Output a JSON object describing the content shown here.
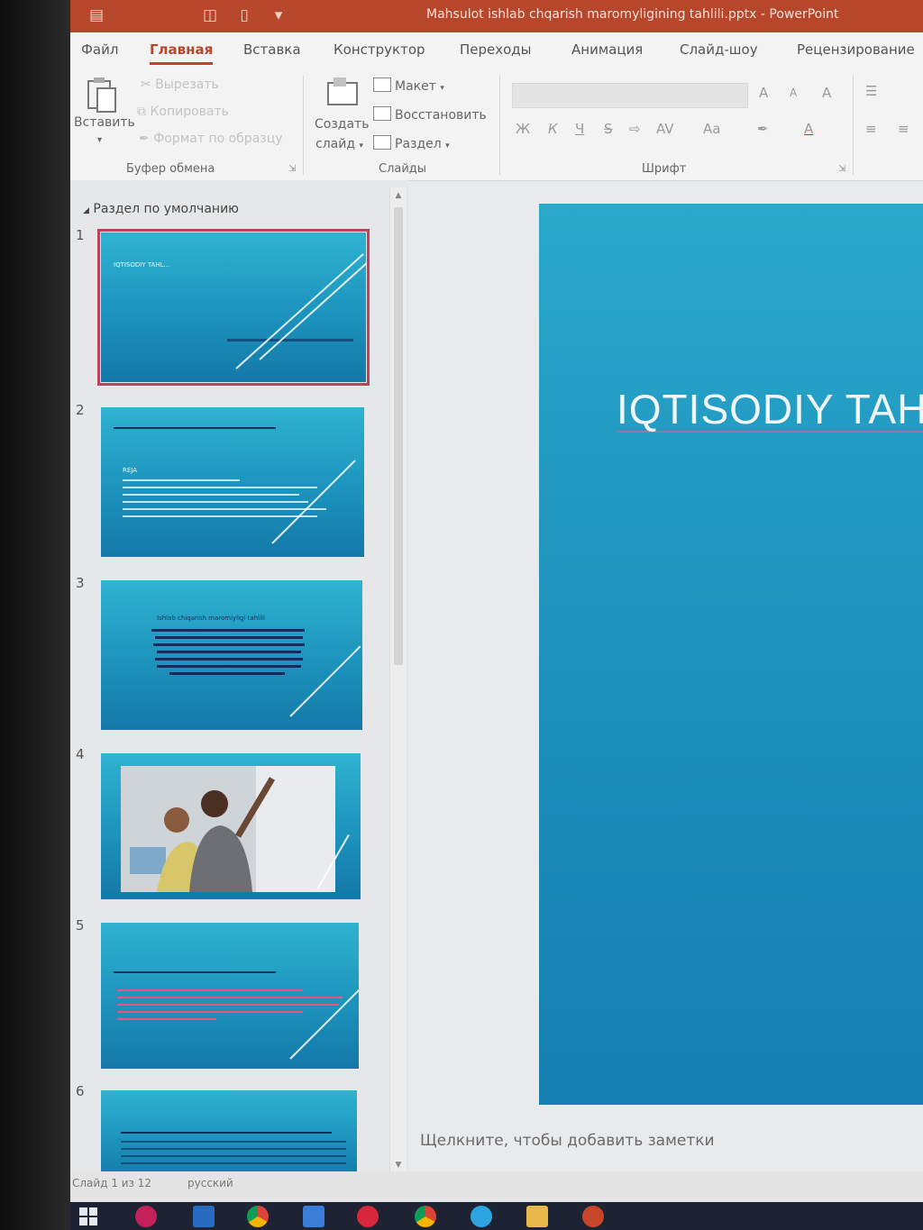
{
  "window": {
    "title": "Mahsulot ishlab chqarish maromyligining tahlili.pptx  -  PowerPoint",
    "qa_icons": [
      "save-icon",
      "present-icon",
      "new-file-icon",
      "customize-icon"
    ]
  },
  "ribbon_tabs": [
    "Файл",
    "Главная",
    "Вставка",
    "Конструктор",
    "Переходы",
    "Анимация",
    "Слайд-шоу",
    "Рецензирование"
  ],
  "ribbon": {
    "clipboard": {
      "paste": "Вставить",
      "cut": "Вырезать",
      "copy": "Копировать",
      "format_painter": "Формат по образцу",
      "label": "Буфер обмена"
    },
    "slides": {
      "new_slide_1": "Создать",
      "new_slide_2": "слайд",
      "layout": "Макет",
      "reset": "Восстановить",
      "section": "Раздел",
      "label": "Слайды"
    },
    "font": {
      "label": "Шрифт",
      "bold": "Ж",
      "italic": "К",
      "underline": "Ч",
      "strike": "S",
      "spacing": "AV",
      "case": "Aa",
      "grow": "A",
      "shrink": "A",
      "clear": "A",
      "color": "A"
    }
  },
  "thumbnails": {
    "section_label": "Раздел по умолчанию",
    "slides": [
      {
        "num": "1",
        "title": "IQTISODIY TAHL..."
      },
      {
        "num": "2",
        "title": "REJA"
      },
      {
        "num": "3",
        "title": "Ishlab chiqarish maromiyligi tahlili"
      },
      {
        "num": "4",
        "title": ""
      },
      {
        "num": "5",
        "title": ""
      },
      {
        "num": "6",
        "title": ""
      }
    ]
  },
  "main_slide": {
    "title": "IQTISODIY TAHL"
  },
  "notes_placeholder": "Щелкните, чтобы добавить заметки",
  "status": {
    "slide_count": "Слайд 1 из 12",
    "language": "русский"
  },
  "colors": {
    "accent": "#b7472a",
    "slide_blue": "#1f95c0",
    "selection": "#c0405e"
  }
}
